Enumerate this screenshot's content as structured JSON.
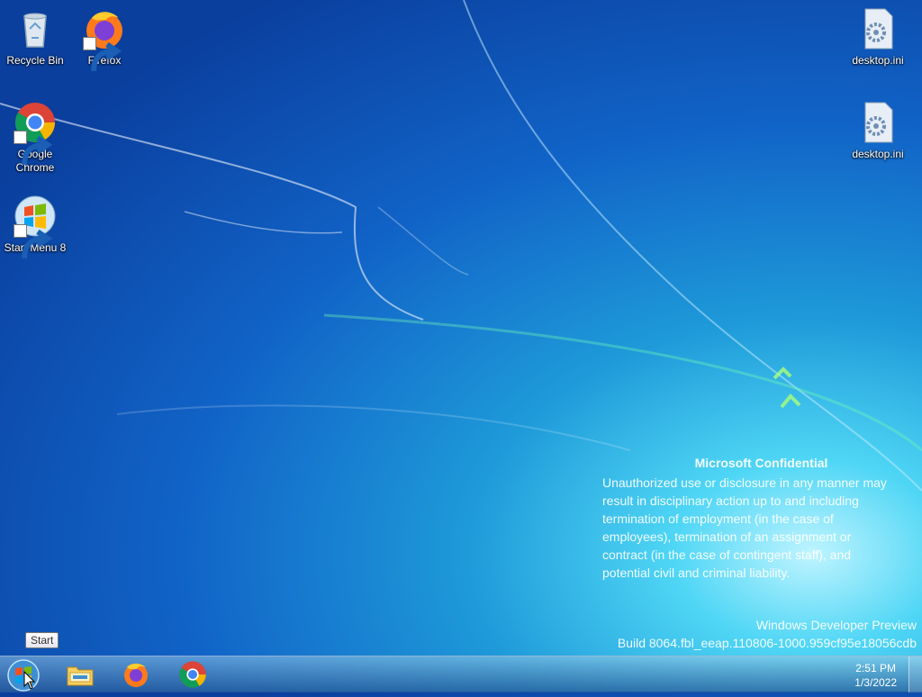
{
  "desktop": {
    "icons": [
      {
        "label": "Recycle Bin",
        "icon": "recycle-bin-icon"
      },
      {
        "label": "Firefox",
        "icon": "firefox-icon"
      },
      {
        "label": "Google Chrome",
        "icon": "chrome-icon"
      },
      {
        "label": "Start Menu 8",
        "icon": "windows-logo-icon"
      },
      {
        "label": "desktop.ini",
        "icon": "settings-file-icon"
      },
      {
        "label": "desktop.ini",
        "icon": "settings-file-icon"
      }
    ]
  },
  "watermark": {
    "title": "Microsoft Confidential",
    "line1": "Unauthorized use or disclosure in any manner may",
    "line2": "result in disciplinary action up to and including",
    "line3": "termination of employment (in the case of",
    "line4": "employees), termination of an assignment or",
    "line5": "contract (in the case of contingent staff), and",
    "line6": "potential civil and criminal liability."
  },
  "build": {
    "line1": "Windows Developer Preview",
    "line2": "Build 8064.fbl_eeap.110806-1000.959cf95e18056cdb"
  },
  "tooltip": {
    "text": "Start"
  },
  "taskbar": {
    "pinned": [
      {
        "name": "File Explorer",
        "icon": "folder-icon"
      },
      {
        "name": "Firefox",
        "icon": "firefox-icon"
      },
      {
        "name": "Google Chrome",
        "icon": "chrome-icon"
      }
    ],
    "clock": {
      "time": "2:51 PM",
      "date": "1/3/2022"
    }
  }
}
